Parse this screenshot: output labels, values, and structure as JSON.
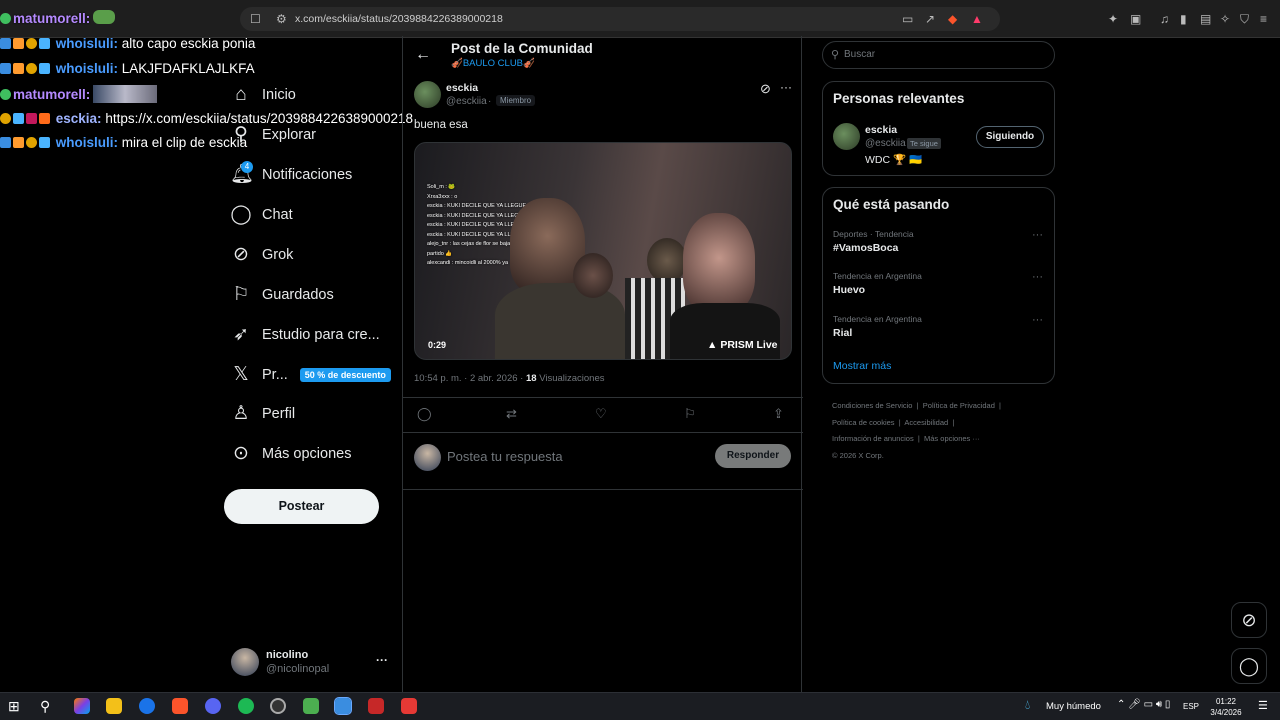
{
  "browser": {
    "url": "x.com/esckiia/status/2039884226389000218"
  },
  "chat_overlay": [
    {
      "user": "matumorell:",
      "message": "",
      "color": "#b58aff"
    },
    {
      "user": "whoisluli:",
      "message": "alto capo esckia ponia",
      "color": "#4a9cff"
    },
    {
      "user": "whoisluli:",
      "message": "LAKJFDAFKLAJLKFA",
      "color": "#4a9cff"
    },
    {
      "user": "matumorell:",
      "message": "",
      "color": "#b58aff"
    },
    {
      "user": "esckia:",
      "message": "https://x.com/esckiia/status/2039884226389000218",
      "color": "#9fb4ff"
    },
    {
      "user": "whoisluli:",
      "message": "mira el clip de esckia",
      "color": "#4a9cff"
    }
  ],
  "nav": {
    "items": [
      {
        "label": "Inicio",
        "icon": "home-icon"
      },
      {
        "label": "Explorar",
        "icon": "search-icon"
      },
      {
        "label": "Notificaciones",
        "icon": "bell-icon",
        "badge": "4"
      },
      {
        "label": "Chat",
        "icon": "chat-icon"
      },
      {
        "label": "Grok",
        "icon": "grok-icon"
      },
      {
        "label": "Guardados",
        "icon": "bookmark-icon"
      },
      {
        "label": "Estudio para cre...",
        "icon": "rocket-icon"
      },
      {
        "label": "Pr...",
        "icon": "x-logo-icon",
        "badge": "50 % de descuento"
      },
      {
        "label": "Perfil",
        "icon": "person-icon"
      },
      {
        "label": "Más opciones",
        "icon": "more-circle-icon"
      }
    ],
    "post_button": "Postear"
  },
  "account": {
    "name": "nicolino",
    "handle": "@nicolinopal"
  },
  "post": {
    "header_title": "Post de la Comunidad",
    "community": "🎻BAULO CLUB🎻",
    "author_name": "esckia",
    "author_handle": "@esckiia",
    "author_role": "Miembro",
    "text": "buena esa",
    "video_duration": "0:29",
    "video_watermark": "PRISM Live",
    "video_chat_lines": [
      "Soli_m : 🐸",
      "Xrxa3xxx : o",
      "esckia : KUKI DECILE QUE YA LLEGUE 👍",
      "esckia : KUKI DECILE QUE YA LLEGUE 👍",
      "esckia : KUKI DECILE QUE YA LLEGUE 👍",
      "esckia : KUKI DECILE QUE YA LLEGUE 👍",
      "alejo_tnr : las cejas de flor se bajaron del partido 👍",
      "alexcandi : mincoidli al 2000% ya"
    ],
    "time": "10:54 p. m. · 2 abr. 2026 ·",
    "views_count": "18",
    "views_label": "Visualizaciones",
    "reply_placeholder": "Postea tu respuesta",
    "reply_button": "Responder"
  },
  "search": {
    "placeholder": "Buscar"
  },
  "relevant": {
    "title": "Personas relevantes",
    "name": "esckia",
    "handle": "@esckiia",
    "follows_you": "Te sigue",
    "bio": "WDC 🏆 🇺🇦",
    "follow_button": "Siguiendo"
  },
  "trends": {
    "title": "Qué está pasando",
    "items": [
      {
        "context": "Deportes · Tendencia",
        "name": "#VamosBoca"
      },
      {
        "context": "Tendencia en Argentina",
        "name": "Huevo"
      },
      {
        "context": "Tendencia en Argentina",
        "name": "Rial"
      }
    ],
    "show_more": "Mostrar más"
  },
  "footer": {
    "links": [
      "Condiciones de Servicio",
      "Política de Privacidad",
      "Política de cookies",
      "Accesibilidad",
      "Información de anuncios",
      "Más opciones ···"
    ],
    "copyright": "© 2026 X Corp."
  },
  "taskbar": {
    "weather": "Muy húmedo",
    "language": "ESP",
    "time": "01:22",
    "date": "3/4/2026"
  },
  "colors": {
    "accent": "#1d9bf0",
    "background": "#000000",
    "border": "#2f3336"
  }
}
